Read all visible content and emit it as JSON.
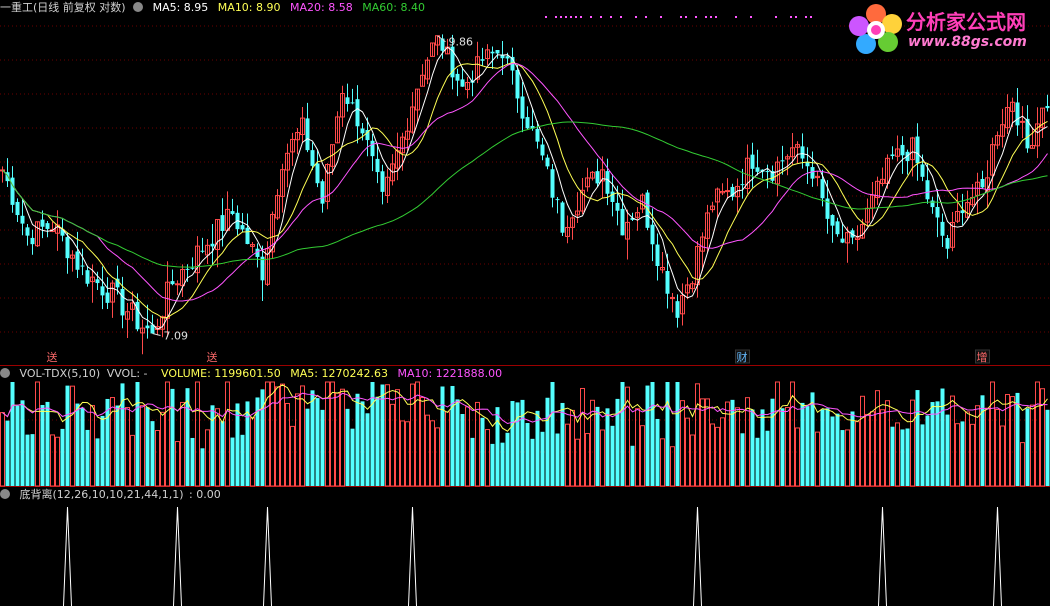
{
  "main_header": {
    "stock_name": "一重工(日线 前复权 对数)",
    "ma5": "MA5: 8.95",
    "ma10": "MA10: 8.90",
    "ma20": "MA20: 8.58",
    "ma60": "MA60: 8.40"
  },
  "vol_header": {
    "name": "VOL-TDX(5,10)",
    "vvol": "VVOL: -",
    "volume": "VOLUME: 1199601.50",
    "ma5": "MA5: 1270242.63",
    "ma10": "MA10: 1221888.00"
  },
  "ind_header": {
    "name": "底背离(12,26,10,10,21,44,1,1)",
    "value": ": 0.00"
  },
  "logo": {
    "text": "分析家公式网",
    "url": "www.88gs.com"
  },
  "colors": {
    "up": "#ff4a4a",
    "down": "#54ffff",
    "ma5": "#ffffff",
    "ma10": "#ffff55",
    "ma20": "#ff55ff",
    "ma60": "#33cc33",
    "grid": "#6b0000",
    "divider": "#9b0000"
  },
  "chart_data": [
    {
      "type": "candlestick",
      "title": "一重工(日线 前复权 对数)",
      "ylim": [
        6.9,
        10.1
      ],
      "price_annotations": [
        {
          "label": "9.86",
          "bar": 87,
          "value": 9.86
        },
        {
          "label": "7.09",
          "bar": 30,
          "value": 7.09
        }
      ],
      "event_markers": [
        {
          "label": "送",
          "bar": 10
        },
        {
          "label": "送",
          "bar": 42
        },
        {
          "label": "财",
          "bar": 148
        },
        {
          "label": "增",
          "bar": 196
        }
      ],
      "ma_lines": [
        "MA5",
        "MA10",
        "MA20",
        "MA60"
      ],
      "anchors": [
        [
          0,
          8.5
        ],
        [
          5,
          7.9
        ],
        [
          10,
          8.0
        ],
        [
          16,
          7.6
        ],
        [
          22,
          7.4
        ],
        [
          28,
          7.15
        ],
        [
          30,
          7.09
        ],
        [
          34,
          7.5
        ],
        [
          40,
          7.8
        ],
        [
          46,
          8.1
        ],
        [
          52,
          7.6
        ],
        [
          56,
          8.6
        ],
        [
          60,
          8.9
        ],
        [
          64,
          8.2
        ],
        [
          68,
          9.3
        ],
        [
          72,
          8.9
        ],
        [
          76,
          8.2
        ],
        [
          80,
          8.8
        ],
        [
          84,
          9.5
        ],
        [
          87,
          9.86
        ],
        [
          92,
          9.3
        ],
        [
          96,
          9.6
        ],
        [
          100,
          9.7
        ],
        [
          104,
          9.1
        ],
        [
          108,
          8.6
        ],
        [
          112,
          8.0
        ],
        [
          116,
          8.3
        ],
        [
          120,
          8.5
        ],
        [
          124,
          8.0
        ],
        [
          128,
          8.2
        ],
        [
          132,
          7.6
        ],
        [
          135,
          7.3
        ],
        [
          138,
          7.6
        ],
        [
          142,
          8.2
        ],
        [
          146,
          8.3
        ],
        [
          150,
          8.6
        ],
        [
          154,
          8.5
        ],
        [
          158,
          8.7
        ],
        [
          162,
          8.5
        ],
        [
          166,
          7.9
        ],
        [
          170,
          7.8
        ],
        [
          174,
          8.2
        ],
        [
          178,
          8.6
        ],
        [
          182,
          8.7
        ],
        [
          186,
          8.1
        ],
        [
          189,
          7.8
        ],
        [
          192,
          8.2
        ],
        [
          196,
          8.3
        ],
        [
          199,
          8.9
        ],
        [
          202,
          9.2
        ],
        [
          205,
          8.7
        ],
        [
          208,
          9.1
        ]
      ]
    },
    {
      "type": "bar",
      "title": "VOL-TDX(5,10)",
      "values_last": {
        "VOLUME": 1199601.5,
        "MA5": 1270242.63,
        "MA10": 1221888.0
      }
    },
    {
      "type": "line",
      "title": "底背离(12,26,10,10,21,44,1,1)",
      "value": 0.0,
      "spike_bars": [
        13,
        35,
        53,
        82,
        139,
        176,
        199
      ]
    }
  ]
}
